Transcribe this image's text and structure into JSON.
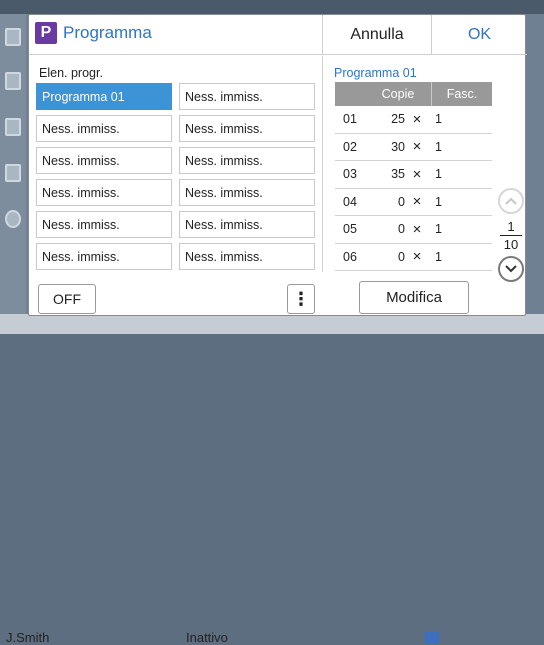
{
  "background": {
    "user": "J.Smith",
    "status": "Inattivo"
  },
  "dialog": {
    "title": "Programma",
    "title_icon": "P",
    "buttons": {
      "cancel": "Annulla",
      "ok": "OK"
    },
    "list_label": "Elen. progr.",
    "slots": [
      "Programma 01",
      "Ness. immiss.",
      "Ness. immiss.",
      "Ness. immiss.",
      "Ness. immiss.",
      "Ness. immiss.",
      "Ness. immiss.",
      "Ness. immiss.",
      "Ness. immiss.",
      "Ness. immiss.",
      "Ness. immiss.",
      "Ness. immiss."
    ],
    "selected_slot": "Programma 01",
    "off_button": "OFF",
    "more_button": "⋮",
    "detail": {
      "title": "Programma 01",
      "columns": {
        "copies": "Copie",
        "sets": "Fasc."
      },
      "rows": [
        {
          "num": "01",
          "copies": "25",
          "times": "×",
          "sets": "1"
        },
        {
          "num": "02",
          "copies": "30",
          "times": "×",
          "sets": "1"
        },
        {
          "num": "03",
          "copies": "35",
          "times": "×",
          "sets": "1"
        },
        {
          "num": "04",
          "copies": "0",
          "times": "×",
          "sets": "1"
        },
        {
          "num": "05",
          "copies": "0",
          "times": "×",
          "sets": "1"
        },
        {
          "num": "06",
          "copies": "0",
          "times": "×",
          "sets": "1"
        }
      ],
      "page_current": "1",
      "page_total": "10",
      "edit_button": "Modifica"
    }
  },
  "colors": {
    "accent": "#2f74c6",
    "selected": "#3c93d6",
    "header_gray": "#999999",
    "program_icon": "#6a3aa3"
  }
}
